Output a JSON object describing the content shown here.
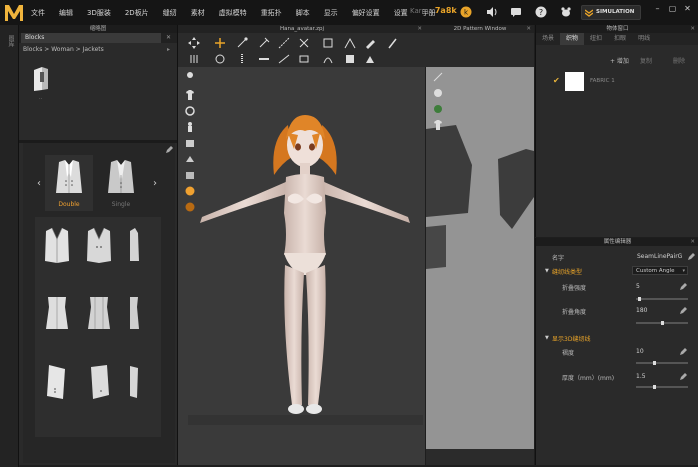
{
  "menubar": {
    "items": [
      "文件",
      "编辑",
      "3D服装",
      "2D板片",
      "缝纫",
      "素材",
      "虚拟模特",
      "重拓扑",
      "脚本",
      "显示",
      "偏好设置",
      "设置",
      "手册"
    ],
    "karma_label": "Karma",
    "karma_value": "7a8k",
    "simulation_label": "SIMULATION"
  },
  "left_strip": {
    "label": "图库"
  },
  "library": {
    "header": "缩略图",
    "tab_label": "Blocks",
    "breadcrumb": "Blocks > Woman > Jackets",
    "file_label": "..",
    "styles": [
      {
        "label": "Double",
        "selected": true
      },
      {
        "label": "Single",
        "selected": false
      }
    ]
  },
  "viewport": {
    "title": "Hana_avatar.zpj"
  },
  "pattern_window": {
    "title": "2D Pattern Window"
  },
  "object_browser": {
    "title": "物体窗口",
    "tabs": [
      "场景",
      "织物",
      "纽扣",
      "扣眼",
      "明线"
    ],
    "active_tab": "织物",
    "add_label": "+ 增加",
    "copy_label": "复制",
    "delete_label": "删除",
    "fabric_name": "FABRIC 1",
    "swatch_color": "#ffffff"
  },
  "property_editor": {
    "title": "属性编辑器",
    "name_label": "名字",
    "name_value": "SeamLinePairG",
    "section1": "缝纫线类型",
    "type_value": "Custom Angle",
    "fold_strength_label": "折叠强度",
    "fold_strength_value": "5",
    "fold_strength_level": 0.05,
    "fold_angle_label": "折叠角度",
    "fold_angle_value": "180",
    "fold_angle_level": 0.5,
    "section2": "显示3D缝纫线",
    "width_label": "褶度",
    "width_value": "10",
    "width_level": 0.35,
    "thickness_label": "厚度（mm）(mm)",
    "thickness_value": "1.5",
    "thickness_level": 0.35
  },
  "colors": {
    "accent": "#e9a429",
    "panel": "#2a2a2a",
    "viewport_bg": "#3a3a3a",
    "pattern_bg": "#8f8f8f"
  }
}
